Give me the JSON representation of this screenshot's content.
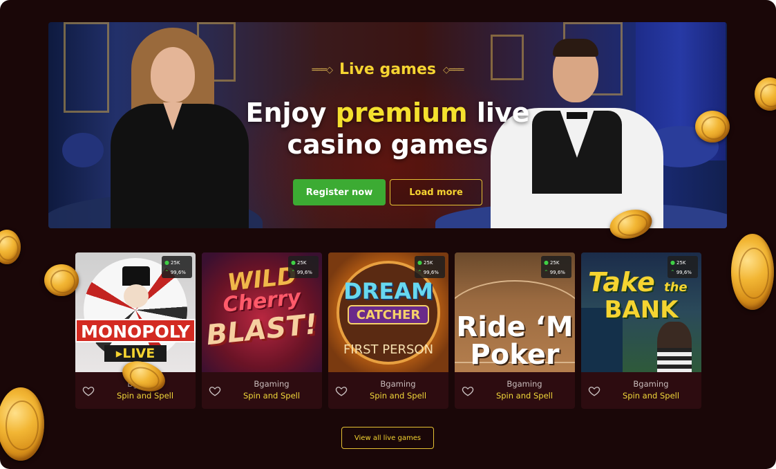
{
  "hero": {
    "eyebrow": "Live games",
    "title_pre": "Enjoy ",
    "title_highlight": "premium",
    "title_post": " live",
    "title_line2": "casino games",
    "register_label": "Register now",
    "load_more_label": "Load more"
  },
  "games": [
    {
      "title": "MONOPOLY LIVE",
      "provider": "Bgaming",
      "name": "Spin and Spell",
      "players": "25K",
      "rtp": "99,6%"
    },
    {
      "title": "Wild Cherry BLAST!",
      "provider": "Bgaming",
      "name": "Spin and Spell",
      "players": "25K",
      "rtp": "99,6%"
    },
    {
      "title": "DREAM CATCHER FIRST PERSON",
      "provider": "Bgaming",
      "name": "Spin and Spell",
      "players": "25K",
      "rtp": "99,6%"
    },
    {
      "title": "Ride 'M Poker",
      "provider": "Bgaming",
      "name": "Spin and Spell",
      "players": "25K",
      "rtp": "99,6%"
    },
    {
      "title": "Take the BANK",
      "provider": "Bgaming",
      "name": "Spin and Spell",
      "players": "25K",
      "rtp": "99,6%"
    }
  ],
  "view_all_label": "View all live  games",
  "colors": {
    "background": "#1a0708",
    "accent_yellow": "#f5d431",
    "register_green": "#3cab33",
    "card_footer": "#2d0c10"
  }
}
